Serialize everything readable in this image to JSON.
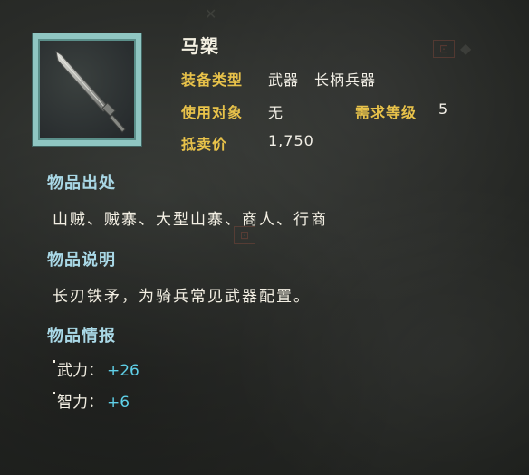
{
  "item": {
    "name": "马槊",
    "icon": "spear-blade-icon",
    "equip_type_label": "装备类型",
    "equip_type_value": "武器　长柄兵器",
    "target_label": "使用对象",
    "target_value": "无",
    "level_label": "需求等级",
    "level_value": "5",
    "price_label": "抵卖价",
    "price_value": "1,750"
  },
  "sections": {
    "origin_title": "物品出处",
    "origin_text": "山贼、贼寨、大型山寨、商人、行商",
    "desc_title": "物品说明",
    "desc_text": "长刃铁矛，为骑兵常见武器配置。",
    "info_title": "物品情报"
  },
  "stats": [
    {
      "label": "武力：",
      "value": "+26"
    },
    {
      "label": "智力：",
      "value": "+6"
    }
  ],
  "colors": {
    "frame": "#8fc6c2",
    "attr_label": "#e8c24a",
    "section_title": "#a9d8e6",
    "stat_value": "#5fd0e8"
  }
}
